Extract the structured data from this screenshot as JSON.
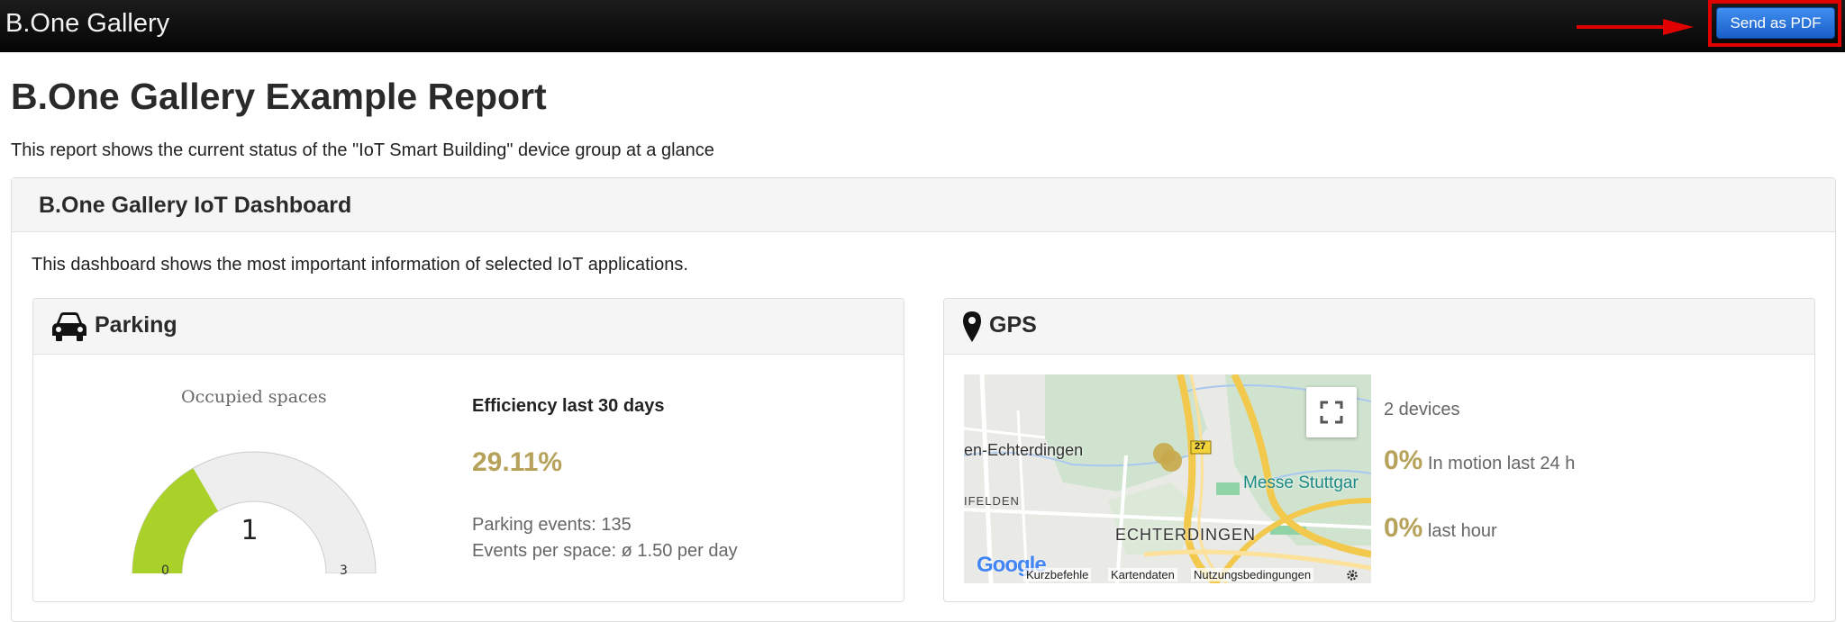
{
  "navbar": {
    "brand": "B.One Gallery",
    "send_pdf_label": "Send as PDF"
  },
  "report": {
    "title": "B.One Gallery Example Report",
    "description": "This report shows the current status of the \"IoT Smart Building\" device group at a glance"
  },
  "dashboard": {
    "title": "B.One Gallery IoT Dashboard",
    "description": "This dashboard shows the most important information of selected IoT applications."
  },
  "parking": {
    "title": "Parking",
    "icon": "car-icon",
    "gauge": {
      "title": "Occupied spaces",
      "value": "1",
      "min": "0",
      "max": "3",
      "fill_fraction": 0.3333,
      "fill_color": "#a9d12a",
      "track_color": "#eeeeee"
    },
    "efficiency": {
      "title": "Efficiency last 30 days",
      "value": "29.11%",
      "events": "Parking events: 135",
      "per_space": "Events per space: ø 1.50 per day"
    }
  },
  "gps": {
    "title": "GPS",
    "icon": "map-marker-icon",
    "map": {
      "labels": {
        "town_left": "en-Echterdingen",
        "felden": "IFELDEN",
        "echterdingen": "ECHTERDINGEN",
        "messe": "Messe Stuttgar",
        "road_badge": "27",
        "google": "Google"
      },
      "footer": {
        "shortcuts": "Kurzbefehle",
        "map_data": "Kartendaten",
        "terms": "Nutzungsbedingungen"
      }
    },
    "devices": "2 devices",
    "motion_24h_value": "0%",
    "motion_24h_label": "In motion last 24 h",
    "last_hour_value": "0%",
    "last_hour_label": "last hour"
  },
  "colors": {
    "accent_gold": "#b6a25a",
    "button_blue": "#2a74dc",
    "highlight_red": "#e00000"
  }
}
